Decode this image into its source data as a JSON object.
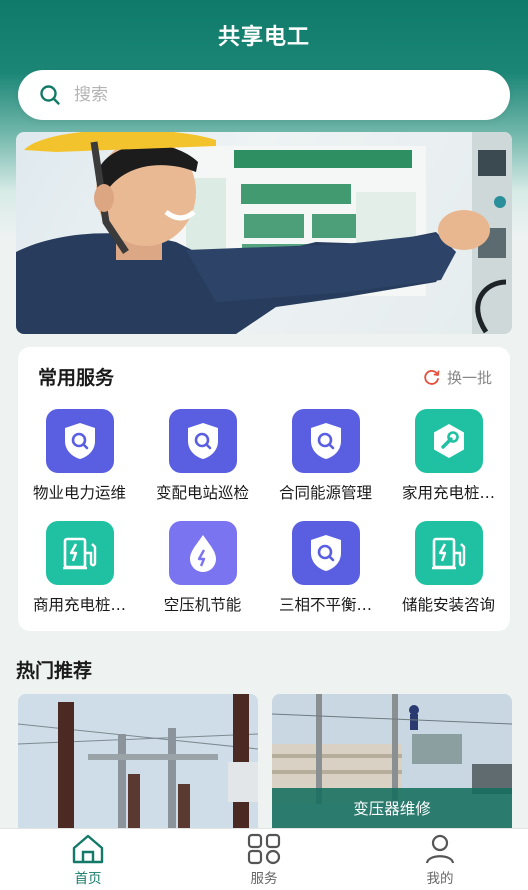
{
  "app": {
    "title": "共享电工"
  },
  "search": {
    "placeholder": "搜索"
  },
  "services": {
    "title": "常用服务",
    "refresh_label": "换一批",
    "items": [
      {
        "label": "物业电力运维",
        "icon": "shield-search-icon"
      },
      {
        "label": "变配电站巡检",
        "icon": "shield-search-icon"
      },
      {
        "label": "合同能源管理",
        "icon": "shield-search-icon"
      },
      {
        "label": "家用充电桩…",
        "icon": "wrench-icon"
      },
      {
        "label": "商用充电桩…",
        "icon": "ev-charger-icon"
      },
      {
        "label": "空压机节能",
        "icon": "energy-drop-icon"
      },
      {
        "label": "三相不平衡…",
        "icon": "shield-search-icon"
      },
      {
        "label": "储能安装咨询",
        "icon": "ev-charger-icon"
      }
    ]
  },
  "hot": {
    "title": "热门推荐",
    "cards": [
      {
        "label": ""
      },
      {
        "label": "变压器维修"
      }
    ]
  },
  "tabbar": {
    "items": [
      {
        "label": "首页",
        "icon": "home-icon",
        "active": true
      },
      {
        "label": "服务",
        "icon": "grid-icon",
        "active": false
      },
      {
        "label": "我的",
        "icon": "user-icon",
        "active": false
      }
    ]
  },
  "colors": {
    "brand": "#137a68",
    "icon_indigo": "#5a5ee0",
    "icon_teal": "#20c1a2",
    "icon_violet": "#7a74f0"
  }
}
